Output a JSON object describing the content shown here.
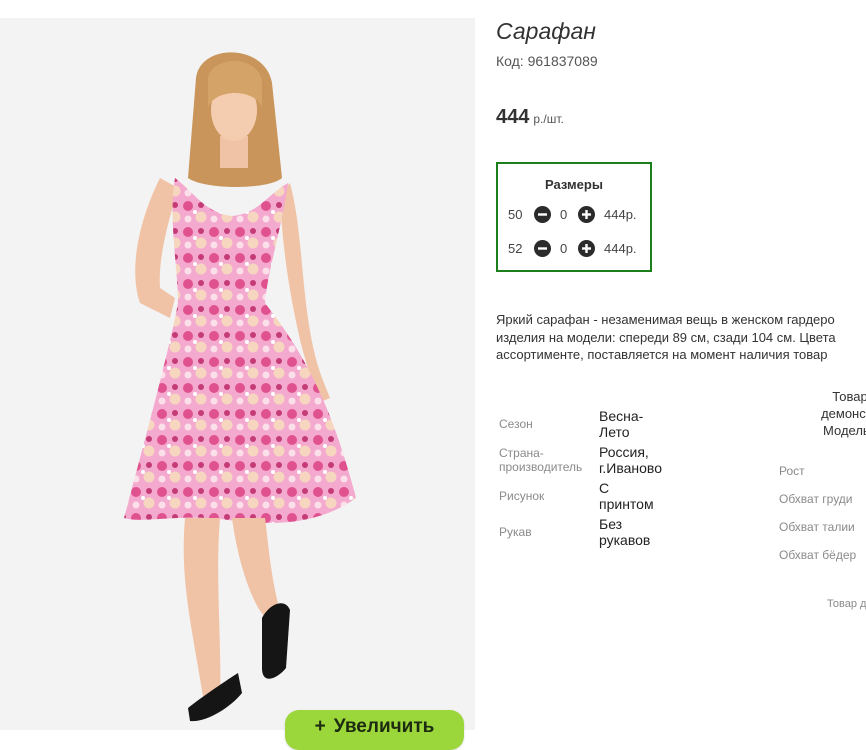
{
  "product": {
    "title": "Сарафан",
    "code": "Код: 961837089",
    "price_amount": "444",
    "price_unit": "р./шт."
  },
  "sizes": {
    "title": "Размеры",
    "rows": [
      {
        "size": "50",
        "qty": "0",
        "sum": "444р."
      },
      {
        "size": "52",
        "qty": "0",
        "sum": "444р."
      }
    ]
  },
  "description": {
    "lines": [
      "Яркий сарафан - незаменимая вещь в женском гардеро",
      "изделия на модели: спереди 89 см, сзади 104 см. Цвета",
      "ассортименте, поставляется на момент наличия товар"
    ]
  },
  "properties": [
    {
      "label_lines": [
        "Сезон"
      ],
      "value_lines": [
        "Весна-",
        "Лето"
      ]
    },
    {
      "label_lines": [
        "Страна-",
        "производитель"
      ],
      "value_lines": [
        "Россия,",
        "г.Иваново"
      ]
    },
    {
      "label_lines": [
        "Рисунок"
      ],
      "value_lines": [
        "С",
        "принтом"
      ]
    },
    {
      "label_lines": [
        "Рукав"
      ],
      "value_lines": [
        "Без",
        "рукавов"
      ]
    }
  ],
  "model": {
    "heading_lines": [
      "Товар",
      "демонстр",
      "Модель I"
    ],
    "measurements": [
      "Рост",
      "Обхват груди",
      "Обхват талии",
      "Обхват бёдер"
    ],
    "note": "Товар д"
  },
  "zoom_button": {
    "label": "Увеличить",
    "icon": "plus-icon"
  },
  "colors": {
    "border_green": "#1b7f1b",
    "zoom_green": "#9bd63a",
    "dress_pink": "#f08cc0"
  },
  "icons": {
    "minus": "minus-circle-icon",
    "plus": "plus-circle-icon"
  }
}
